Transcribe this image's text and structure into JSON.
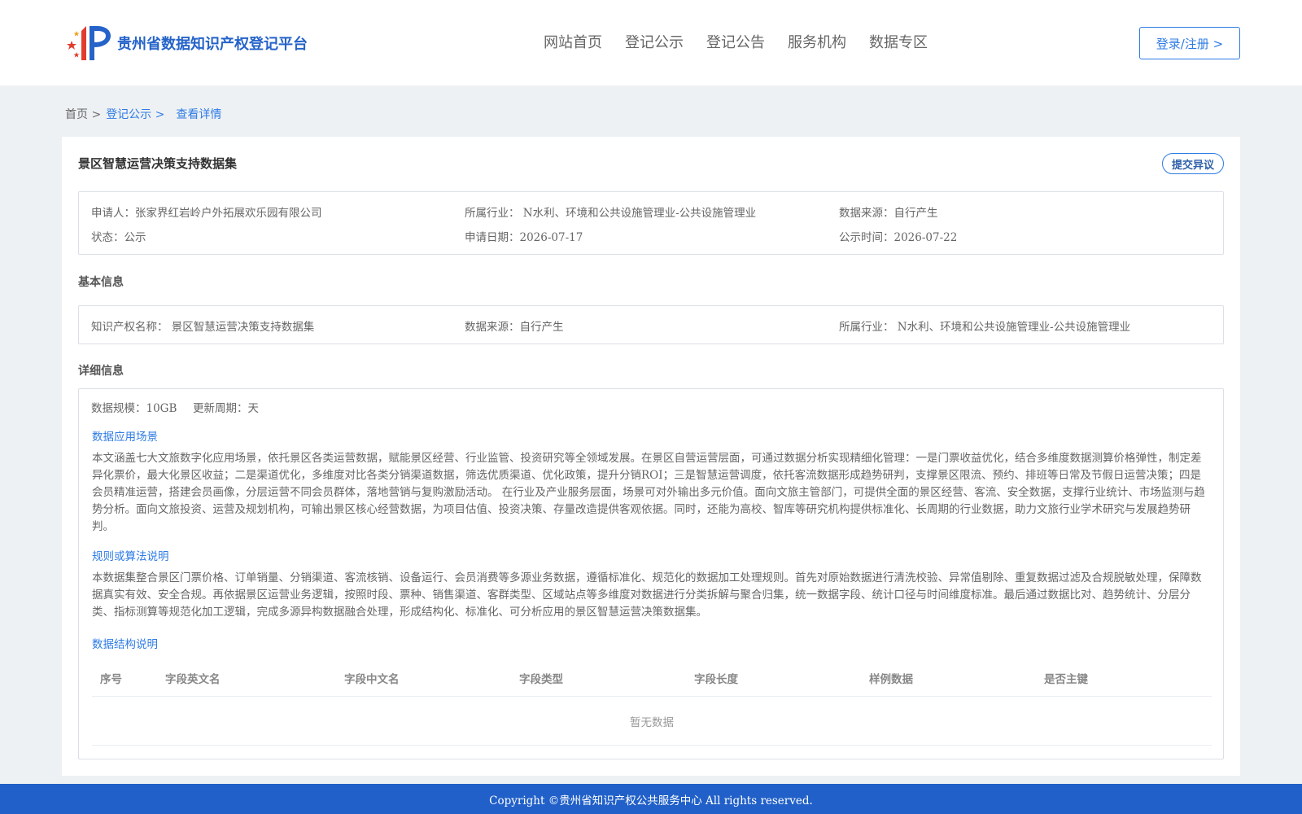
{
  "header": {
    "logo_text": "贵州省数据知识产权登记平台",
    "nav": [
      "网站首页",
      "登记公示",
      "登记公告",
      "服务机构",
      "数据专区"
    ],
    "login_label": "登录/注册 >"
  },
  "breadcrumb": {
    "home": "首页 >",
    "section": "登记公示 >",
    "current": "查看详情"
  },
  "detail": {
    "title": "景区智慧运营决策支持数据集",
    "objection_label": "提交异议",
    "summary": {
      "applicant": "申请人：张家界红岩岭户外拓展欢乐园有限公司",
      "industry": "所属行业： N水利、环境和公共设施管理业-公共设施管理业",
      "source": "数据来源：自行产生",
      "status": "状态：公示",
      "apply_date": "申请日期：2026-07-17",
      "publish_date": "公示时间：2026-07-22"
    },
    "basic_label": "基本信息",
    "basic": {
      "ip_name": "知识产权名称： 景区智慧运营决策支持数据集",
      "source": "数据来源：自行产生",
      "industry": "所属行业： N水利、环境和公共设施管理业-公共设施管理业"
    },
    "detail_label": "详细信息",
    "scale": "数据规模：10GB",
    "period": "更新周期：天",
    "scenario_title": "数据应用场景",
    "scenario_text": "本文涵盖七大文旅数字化应用场景，依托景区各类运营数据，赋能景区经营、行业监管、投资研究等全领域发展。在景区自营运营层面，可通过数据分析实现精细化管理：一是门票收益优化，结合多维度数据测算价格弹性，制定差异化票价，最大化景区收益；二是渠道优化，多维度对比各类分销渠道数据，筛选优质渠道、优化政策，提升分销ROI；三是智慧运营调度，依托客流数据形成趋势研判，支撑景区限流、预约、排班等日常及节假日运营决策；四是会员精准运营，搭建会员画像，分层运营不同会员群体，落地营销与复购激励活动。 在行业及产业服务层面，场景可对外输出多元价值。面向文旅主管部门，可提供全面的景区经营、客流、安全数据，支撑行业统计、市场监测与趋势分析。面向文旅投资、运营及规划机构，可输出景区核心经营数据，为项目估值、投资决策、存量改造提供客观依据。同时，还能为高校、智库等研究机构提供标准化、长周期的行业数据，助力文旅行业学术研究与发展趋势研判。",
    "rules_title": "规则或算法说明",
    "rules_text": "本数据集整合景区门票价格、订单销量、分销渠道、客流核销、设备运行、会员消费等多源业务数据，遵循标准化、规范化的数据加工处理规则。首先对原始数据进行清洗校验、异常值剔除、重复数据过滤及合规脱敏处理，保障数据真实有效、安全合规。再依据景区运营业务逻辑，按照时段、票种、销售渠道、客群类型、区域站点等多维度对数据进行分类拆解与聚合归集，统一数据字段、统计口径与时间维度标准。最后通过数据比对、趋势统计、分层分类、指标测算等规范化加工逻辑，完成多源异构数据融合处理，形成结构化、标准化、可分析应用的景区智慧运营决策数据集。",
    "structure_title": "数据结构说明",
    "table_headers": [
      "序号",
      "字段英文名",
      "字段中文名",
      "字段类型",
      "字段长度",
      "样例数据",
      "是否主键"
    ],
    "empty_text": "暂无数据"
  },
  "footer": {
    "copyright": "Copyright ©贵州省知识产权公共服务中心 All rights reserved."
  },
  "colors": {
    "primary": "#2d7be5",
    "logo_blue": "#2563c9",
    "footer_bg": "#2160c8",
    "page_bg": "#eef1f4"
  }
}
